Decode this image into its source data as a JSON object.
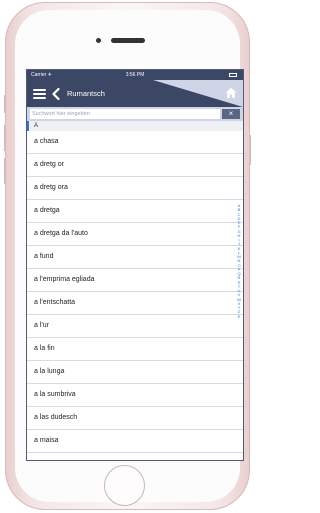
{
  "status_bar": {
    "carrier": "Carrier ✈︎",
    "time": "3:56 PM"
  },
  "nav": {
    "title": "Rumantsch",
    "menu_icon": "hamburger-menu-icon",
    "back_icon": "chevron-left-icon",
    "home_icon": "home-icon"
  },
  "search": {
    "placeholder": "Suchwort hier eingeben",
    "clear_label": "×"
  },
  "section": {
    "letter": "A"
  },
  "entries": [
    "a chasa",
    "a dretg or",
    "a dretg ora",
    "a dretga",
    "a dretga da l'auto",
    "a fund",
    "a l'emprima egliada",
    "a l'entschatta",
    "a l'ur",
    "a la fin",
    "a la lunga",
    "a la sumbriva",
    "a las dudesch",
    "a maisa"
  ],
  "index_letters": [
    "A",
    "B",
    "C",
    "D",
    "E",
    "F",
    "G",
    "H",
    "I",
    "J",
    "K",
    "L",
    "M",
    "N",
    "O",
    "P",
    "Q",
    "R",
    "S",
    "T",
    "U",
    "V",
    "W",
    "X",
    "Y",
    "Z",
    "È"
  ],
  "colors": {
    "nav_bg": "#3c4765",
    "accent": "#3b6fd4",
    "search_bg": "#cfd5e6"
  }
}
